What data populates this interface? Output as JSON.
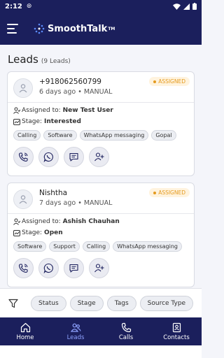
{
  "status": {
    "time": "2:12"
  },
  "app": {
    "brand": "SmoothTalk",
    "tm": "TM"
  },
  "page": {
    "title": "Leads",
    "count": "(9 Leads)"
  },
  "leads": [
    {
      "name": "+918062560799",
      "age": "6 days ago",
      "source": "MANUAL",
      "badge": "ASSIGNED",
      "assigned_label": "Assigned to:",
      "assigned_to": "New Test User",
      "stage_label": "Stage:",
      "stage": "Interested",
      "tags": [
        "Calling",
        "Software",
        "WhatsApp messaging",
        "Gopal"
      ]
    },
    {
      "name": "Nishtha",
      "age": "7 days ago",
      "source": "MANUAL",
      "badge": "ASSIGNED",
      "assigned_label": "Assigned to:",
      "assigned_to": "Ashish Chauhan",
      "stage_label": "Stage:",
      "stage": "Open",
      "tags": [
        "Software",
        "Support",
        "Calling",
        "WhatsApp messaging"
      ]
    }
  ],
  "filters": [
    "Status",
    "Stage",
    "Tags",
    "Source Type"
  ],
  "nav": [
    {
      "label": "Home",
      "icon": "home-icon"
    },
    {
      "label": "Leads",
      "icon": "people-icon"
    },
    {
      "label": "Calls",
      "icon": "phone-icon"
    },
    {
      "label": "Contacts",
      "icon": "contacts-icon"
    }
  ],
  "colors": {
    "primary": "#1b1f5c",
    "badge": "#e49a1e",
    "active": "#8fa3ff"
  }
}
